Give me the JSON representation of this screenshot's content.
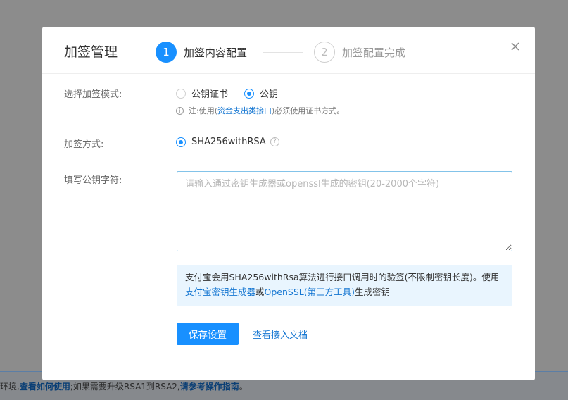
{
  "background": {
    "notice": {
      "prefix": "环境,",
      "link1": "查看如何使用",
      "middle": ";如果需要升级RSA1到RSA2,",
      "link2": "请参考操作指南",
      "suffix": "。"
    }
  },
  "modal": {
    "title": "加签管理",
    "steps": [
      {
        "number": "1",
        "label": "加签内容配置",
        "state": "active"
      },
      {
        "number": "2",
        "label": "加签配置完成",
        "state": "inactive"
      }
    ],
    "close_icon": "close-icon"
  },
  "form": {
    "mode": {
      "label": "选择加签模式:",
      "options": [
        {
          "label": "公钥证书",
          "checked": false
        },
        {
          "label": "公钥",
          "checked": true
        }
      ],
      "hint": {
        "prefix": "注:使用(",
        "link": "资金支出类接口",
        "suffix": ")必须使用证书方式。"
      }
    },
    "method": {
      "label": "加签方式:",
      "option": {
        "label": "SHA256withRSA",
        "checked": true
      }
    },
    "public_key": {
      "label": "填写公钥字符:",
      "value": "",
      "placeholder": "请输入通过密钥生成器或openssl生成的密钥(20-2000个字符)"
    },
    "tip": {
      "text1": "支付宝会用SHA256withRsa算法进行接口调用时的验签(不限制密钥长度)。使用",
      "link1": "支付宝密钥生成器",
      "text2": "或",
      "link2": "OpenSSL(第三方工具)",
      "text3": "生成密钥"
    },
    "save_label": "保存设置",
    "doc_link": "查看接入文档"
  },
  "colors": {
    "accent": "#1890ff",
    "link": "#1677d2",
    "tip_bg": "#e9f5fe"
  }
}
